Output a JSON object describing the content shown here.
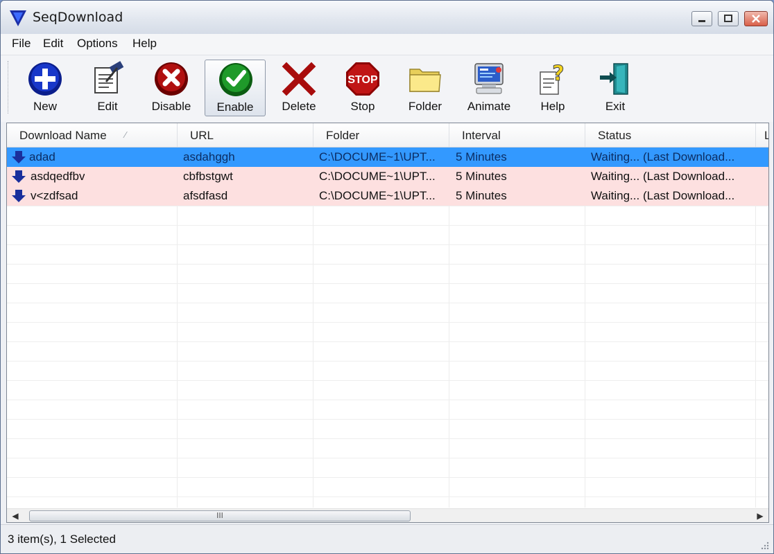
{
  "window": {
    "title": "SeqDownload",
    "controls": {
      "minimize": "minimize",
      "maximize": "maximize",
      "close": "close"
    }
  },
  "menu": [
    {
      "label": "File"
    },
    {
      "label": "Edit"
    },
    {
      "label": "Options"
    },
    {
      "label": "Help"
    }
  ],
  "toolbar": [
    {
      "label": "New",
      "icon": "new-icon"
    },
    {
      "label": "Edit",
      "icon": "edit-icon"
    },
    {
      "label": "Disable",
      "icon": "disable-icon"
    },
    {
      "label": "Enable",
      "icon": "enable-icon",
      "pressed": true
    },
    {
      "label": "Delete",
      "icon": "delete-icon"
    },
    {
      "label": "Stop",
      "icon": "stop-icon",
      "icon_text": "STOP"
    },
    {
      "label": "Folder",
      "icon": "folder-icon"
    },
    {
      "label": "Animate",
      "icon": "animate-icon"
    },
    {
      "label": "Help",
      "icon": "help-icon"
    },
    {
      "label": "Exit",
      "icon": "exit-icon"
    }
  ],
  "list": {
    "columns": [
      "Download Name",
      "URL",
      "Folder",
      "Interval",
      "Status",
      "L"
    ],
    "rows": [
      {
        "name": "adad",
        "url": "asdahggh",
        "folder": "C:\\DOCUME~1\\UPT...",
        "interval": "5 Minutes",
        "status": "Waiting... (Last Download...",
        "selected": true
      },
      {
        "name": "asdqedfbv",
        "url": "cbfbstgwt",
        "folder": "C:\\DOCUME~1\\UPT...",
        "interval": "5 Minutes",
        "status": "Waiting... (Last Download...",
        "selected": false
      },
      {
        "name": "v<zdfsad",
        "url": "afsdfasd",
        "folder": "C:\\DOCUME~1\\UPT...",
        "interval": "5 Minutes",
        "status": "Waiting... (Last Download...",
        "selected": false
      }
    ],
    "colors": {
      "selected_row": "#3399ff",
      "row_highlight": "#fde0e0"
    }
  },
  "scrollbar": {
    "left_arrow": "◀",
    "right_arrow": "▶",
    "thumb_grip": "III"
  },
  "status": {
    "text": "3 item(s), 1 Selected"
  }
}
